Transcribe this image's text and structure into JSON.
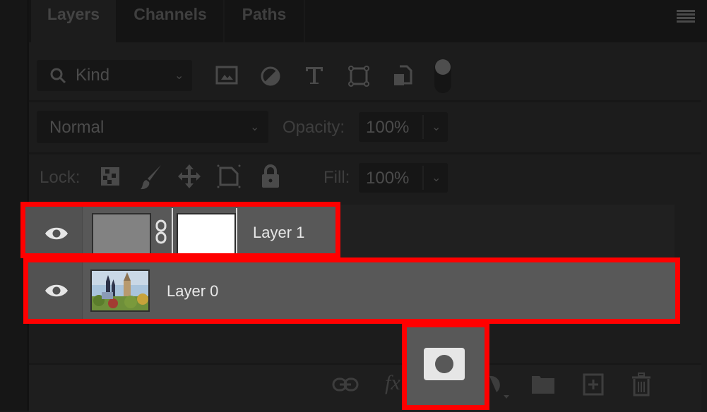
{
  "tabs": [
    {
      "label": "Layers",
      "active": true
    },
    {
      "label": "Channels",
      "active": false
    },
    {
      "label": "Paths",
      "active": false
    }
  ],
  "panel_menu_icon": "hamburger-icon",
  "filter": {
    "search_icon": "search-icon",
    "kind_label": "Kind",
    "filter_icons": [
      "pixel-layer-filter-icon",
      "adjustment-layer-filter-icon",
      "type-layer-filter-icon",
      "shape-layer-filter-icon",
      "smart-object-filter-icon",
      "filter-toggle-icon"
    ]
  },
  "blend": {
    "mode": "Normal",
    "opacity_label": "Opacity:",
    "opacity_value": "100%"
  },
  "lock": {
    "label": "Lock:",
    "icons": [
      "lock-transparent-pixels-icon",
      "lock-image-pixels-icon",
      "lock-position-icon",
      "lock-artboard-icon",
      "lock-all-icon"
    ],
    "fill_label": "Fill:",
    "fill_value": "100%"
  },
  "layers": [
    {
      "name": "Layer 1",
      "visible": true,
      "thumbnail": "gray-fill",
      "has_mask": true,
      "mask_color": "#ffffff",
      "highlighted": true
    },
    {
      "name": "Layer 0",
      "visible": true,
      "thumbnail": "castle-photo",
      "has_mask": false,
      "highlighted": true
    }
  ],
  "bottom_bar": {
    "icons": [
      "link-layers-icon",
      "layer-style-fx-icon",
      "add-layer-mask-icon",
      "adjustment-layer-icon",
      "new-group-icon",
      "new-layer-icon",
      "delete-layer-icon"
    ],
    "fx_label": "fx",
    "highlighted": "add-layer-mask-icon"
  },
  "colors": {
    "highlight": "#ff0000",
    "panel_bg": "#1c1c1c",
    "selected_row": "#585858"
  }
}
